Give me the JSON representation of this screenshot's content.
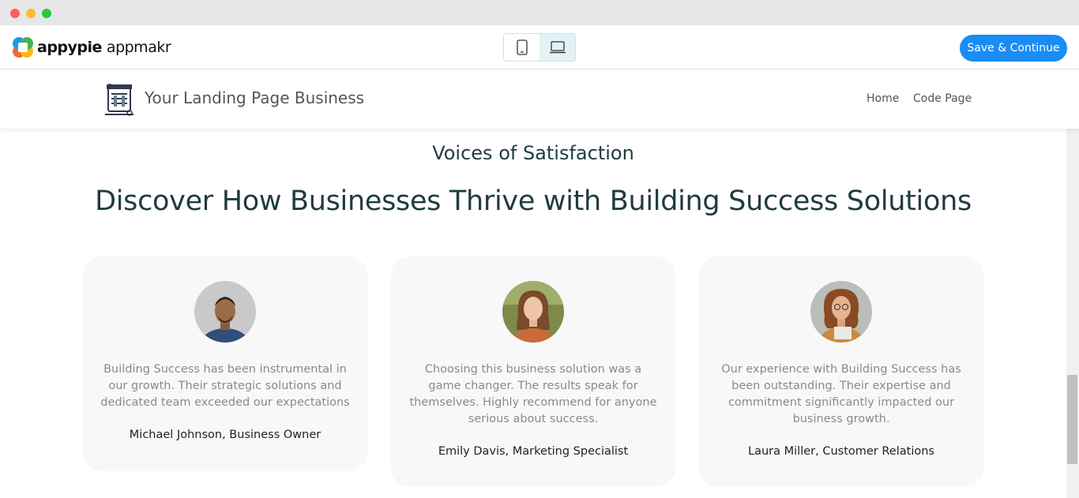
{
  "window": {
    "controls": [
      "close",
      "minimize",
      "maximize"
    ]
  },
  "toolbar": {
    "brand_name": "appypie",
    "brand_product": "appmakr",
    "devices": [
      {
        "icon": "mobile-icon",
        "active": false
      },
      {
        "icon": "desktop-icon",
        "active": true
      }
    ],
    "save_label": "Save & Continue"
  },
  "site": {
    "title": "Your Landing Page Business",
    "nav": {
      "home": "Home",
      "code": "Code Page"
    }
  },
  "section": {
    "subtitle": "Voices of Satisfaction",
    "title": "Discover How Businesses Thrive with Building Success Solutions"
  },
  "testimonials": [
    {
      "quote": "Building Success has been instrumental in our growth. Their strategic solutions and dedicated team exceeded our expectations",
      "author": "Michael Johnson, Business Owner"
    },
    {
      "quote": "Choosing this business solution was a game changer. The results speak for themselves. Highly recommend for anyone serious about success.",
      "author": "Emily Davis, Marketing Specialist"
    },
    {
      "quote": "Our experience with Building Success has been outstanding. Their expertise and commitment significantly impacted our business growth.",
      "author": "Laura Miller, Customer Relations"
    }
  ],
  "colors": {
    "accent": "#1a8cf5",
    "heading": "#1f3b40",
    "card_bg": "#f8f8f8",
    "active_device_bg": "#e3f2f7"
  }
}
